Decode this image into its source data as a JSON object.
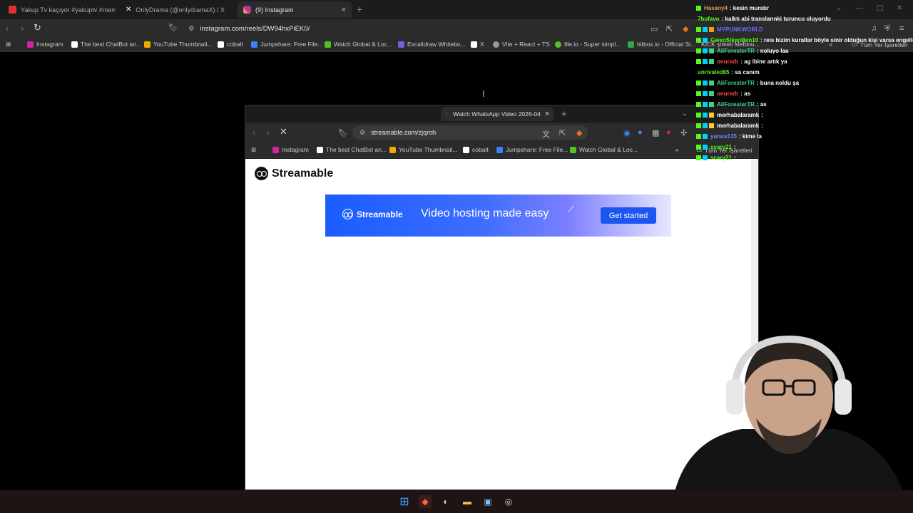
{
  "outer": {
    "tabs": [
      {
        "title": "Yakup Tv kaçıyor #yakuptv #memes",
        "icon": "youtube-icon",
        "color": "#e03030"
      },
      {
        "title": "OnlyDrama (@onlydramaX) / X",
        "icon": "x-icon",
        "color": "#ffffff"
      },
      {
        "title": "(9) Instagram",
        "icon": "instagram-icon",
        "color": "#d6249f"
      }
    ],
    "url": "instagram.com/reels/DW94hxPiEK0/",
    "bookmarks": [
      {
        "label": "Instagram",
        "color": "#d6249f"
      },
      {
        "label": "The best ChatBot an...",
        "color": "#ffffff"
      },
      {
        "label": "YouTube Thumbnail...",
        "color": "#f2a900"
      },
      {
        "label": "cobalt",
        "color": "#ffffff"
      },
      {
        "label": "Jumpshare: Free File...",
        "color": "#3b82f6"
      },
      {
        "label": "Watch Global & Loc...",
        "color": "#53c02a"
      },
      {
        "label": "Excalidraw Whitebo...",
        "color": "#6965db"
      },
      {
        "label": "X",
        "color": "#ffffff"
      },
      {
        "label": "Vite + React + TS",
        "color": "#999999"
      },
      {
        "label": "file.io - Super simpl...",
        "color": "#53c02a"
      },
      {
        "label": "hitbox.io - Official Si...",
        "color": "#2eaa4a"
      }
    ],
    "bookmarks_extra": "KICK şirketi Melbou...",
    "all_bookmarks": "Tüm Yer İşaretleri"
  },
  "chat": [
    {
      "user": "Hasany4",
      "text": ": kesin muratır",
      "color": "#d7a14a",
      "badges": [
        "#53fc18"
      ]
    },
    {
      "user": "7bufavo",
      "text": ": kalktı abi translarınki turuncu oluyordu",
      "color": "#53fc18",
      "badges": []
    },
    {
      "user": "MYPUNKWORLD",
      "text": "",
      "color": "#6b6bff",
      "badges": [
        "#53fc18",
        "#00d2ff",
        "#ff9900"
      ]
    },
    {
      "user": "GwenSikenBen10",
      "text": ": reis bizim kurallar böyle sinir olduğun kişi varsa engelle",
      "color": "#53fc18",
      "badges": [
        "#53fc18",
        "#00d2ff"
      ]
    },
    {
      "user": "AliForesterTR",
      "text": ": noluyo laa",
      "color": "#3fcf8e",
      "badges": [
        "#53fc18",
        "#00d2ff",
        "#3fcf8e"
      ]
    },
    {
      "user": "onurxdr",
      "text": ": ag ibine artık ya",
      "color": "#ff4b4b",
      "badges": [
        "#53fc18",
        "#00d2ff",
        "#3fcf8e"
      ]
    },
    {
      "user": "unrivaled65",
      "text": ": sa canım",
      "color": "#53fc18",
      "badges": []
    },
    {
      "user": "AliForesterTR",
      "text": ": buna noldu şa",
      "color": "#3fcf8e",
      "badges": [
        "#53fc18",
        "#00d2ff",
        "#3fcf8e"
      ]
    },
    {
      "user": "onurxdr",
      "text": ": as",
      "color": "#ff4b4b",
      "badges": [
        "#53fc18",
        "#00d2ff",
        "#3fcf8e"
      ]
    },
    {
      "user": "AliForesterTR",
      "text": ": as",
      "color": "#3fcf8e",
      "badges": [
        "#53fc18",
        "#00d2ff",
        "#3fcf8e"
      ]
    },
    {
      "user": "merhabalaramk",
      "text": ":",
      "color": "#ffffff",
      "badges": [
        "#53fc18",
        "#00d2ff",
        "#ffcc33"
      ]
    },
    {
      "user": "merhabalaramk",
      "text": ":",
      "color": "#ffffff",
      "badges": [
        "#53fc18",
        "#00d2ff",
        "#ffcc33"
      ]
    },
    {
      "user": "yunus135",
      "text": ": kime la",
      "color": "#6b8cff",
      "badges": [
        "#53fc18",
        "#00d2ff"
      ]
    },
    {
      "user": "scary21",
      "text": ":",
      "color": "#53fc18",
      "badges": [
        "#53fc18",
        "#00d2ff"
      ]
    },
    {
      "user": "scary21",
      "text": ":",
      "color": "#53fc18",
      "badges": [
        "#53fc18",
        "#00d2ff"
      ]
    }
  ],
  "inner": {
    "tab_title": "Watch WhatsApp Video 2026-04",
    "url": "streamable.com/zjqroh",
    "bookmarks": [
      {
        "label": "Instagram",
        "color": "#d6249f"
      },
      {
        "label": "The best ChatBot an...",
        "color": "#ffffff"
      },
      {
        "label": "YouTube Thumbnail...",
        "color": "#f2a900"
      },
      {
        "label": "cobalt",
        "color": "#ffffff"
      },
      {
        "label": "Jumpshare: Free File...",
        "color": "#3b82f6"
      },
      {
        "label": "Watch Global & Loc...",
        "color": "#53c02a"
      }
    ],
    "all_bookmarks": "Tüm Yer İşaretleri"
  },
  "streamable": {
    "logo": "Streamable",
    "banner_logo": "Streamable",
    "tagline": "Video hosting made easy",
    "cta": "Get started",
    "brand_color": "#1c55f0"
  }
}
